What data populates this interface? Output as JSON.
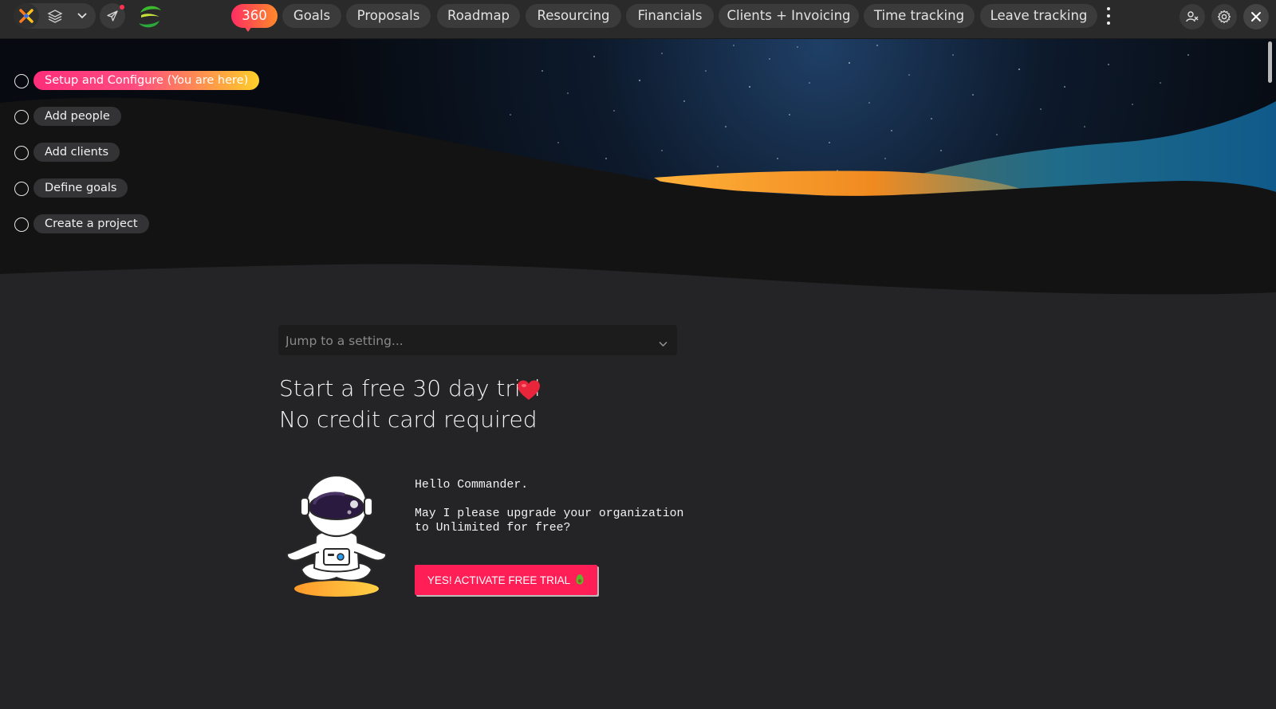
{
  "nav": {
    "items": [
      {
        "label": "360"
      },
      {
        "label": "Goals"
      },
      {
        "label": "Proposals"
      },
      {
        "label": "Roadmap"
      },
      {
        "label": "Resourcing"
      },
      {
        "label": "Financials"
      },
      {
        "label": "Clients + Invoicing"
      },
      {
        "label": "Time tracking"
      },
      {
        "label": "Leave tracking"
      }
    ],
    "icons": [
      "app-logo-icon",
      "layers-icon",
      "chevron-down-icon",
      "send-icon",
      "brand-logo-icon",
      "more-vertical-icon",
      "account-switch-icon",
      "gear-icon",
      "close-icon"
    ]
  },
  "steps": [
    {
      "label": "Setup and Configure (You are here)",
      "active": true
    },
    {
      "label": "Add people",
      "active": false
    },
    {
      "label": "Add clients",
      "active": false
    },
    {
      "label": "Define goals",
      "active": false
    },
    {
      "label": "Create a project",
      "active": false
    }
  ],
  "jump": {
    "placeholder": "Jump to a setting..."
  },
  "trial": {
    "line1": "Start a free 30 day trial",
    "line2": "No credit card required"
  },
  "message": {
    "greeting": "Hello Commander.",
    "body": "May I please upgrade your organization\nto Unlimited for free?"
  },
  "cta": {
    "label": "YES! ACTIVATE FREE TRIAL"
  },
  "colors": {
    "accent": "#ff1e56",
    "accent_gradient_end": "#ffd02a",
    "topbar": "#2a2a2b",
    "background": "#242426"
  }
}
